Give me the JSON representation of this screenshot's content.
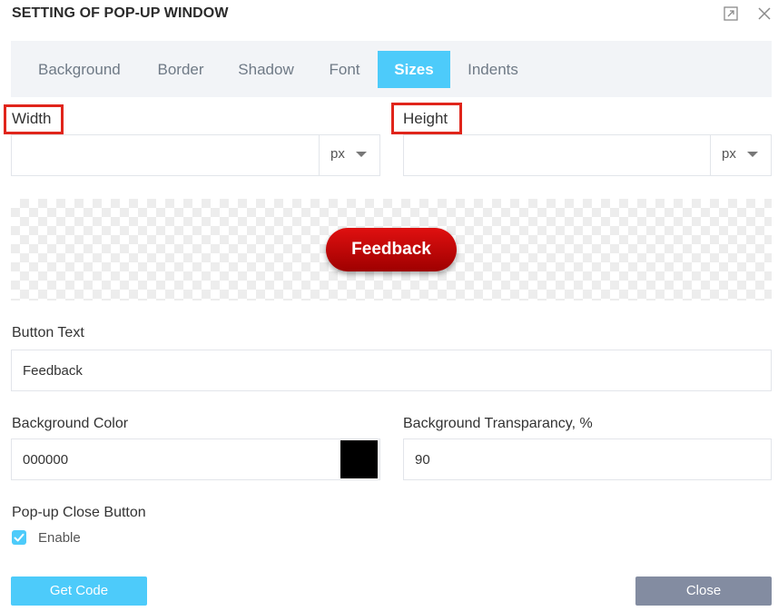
{
  "header": {
    "title": "SETTING OF POP-UP WINDOW",
    "maximize_icon": "expand-icon",
    "close_icon": "close-icon"
  },
  "tabs": [
    {
      "label": "Background",
      "active": false
    },
    {
      "label": "Border",
      "active": false
    },
    {
      "label": "Shadow",
      "active": false
    },
    {
      "label": "Font",
      "active": false
    },
    {
      "label": "Sizes",
      "active": true
    },
    {
      "label": "Indents",
      "active": false
    }
  ],
  "sizes": {
    "width": {
      "label": "Width",
      "value": "",
      "unit": "px"
    },
    "height": {
      "label": "Height",
      "value": "",
      "unit": "px"
    }
  },
  "preview": {
    "button_text": "Feedback"
  },
  "button_text": {
    "label": "Button Text",
    "value": "Feedback"
  },
  "background_color": {
    "label": "Background Color",
    "value": "000000",
    "swatch": "#000000"
  },
  "background_transparency": {
    "label": "Background Transparancy, %",
    "value": "90"
  },
  "close_button": {
    "label": "Pop-up Close Button",
    "checkbox_label": "Enable",
    "checked": true
  },
  "footer": {
    "get_code_label": "Get Code",
    "close_label": "Close"
  },
  "colors": {
    "accent": "#4dcbfa",
    "close_button_bg": "#838ca1",
    "highlight_box": "#e0251b"
  }
}
